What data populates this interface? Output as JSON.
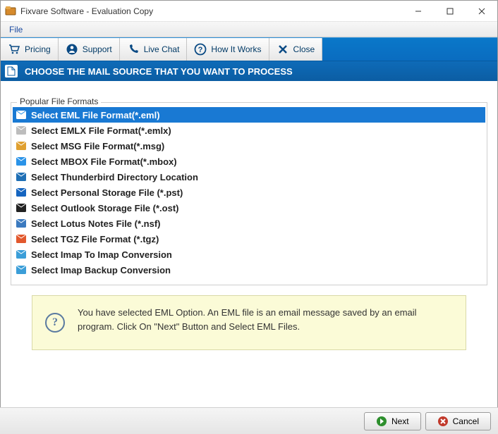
{
  "window": {
    "title": "Fixvare Software - Evaluation Copy"
  },
  "menubar": {
    "file": "File"
  },
  "toolbar": {
    "pricing": "Pricing",
    "support": "Support",
    "livechat": "Live Chat",
    "howitworks": "How It Works",
    "close": "Close"
  },
  "header": {
    "text": "CHOOSE THE MAIL SOURCE THAT YOU WANT TO PROCESS"
  },
  "group": {
    "title": "Popular File Formats"
  },
  "formats": [
    {
      "label": "Select EML File Format(*.eml)",
      "icon_color": "#2a93e8",
      "selected": true
    },
    {
      "label": "Select EMLX File Format(*.emlx)",
      "icon_color": "#bdbdbd",
      "selected": false
    },
    {
      "label": "Select MSG File Format(*.msg)",
      "icon_color": "#e0a030",
      "selected": false
    },
    {
      "label": "Select MBOX File Format(*.mbox)",
      "icon_color": "#2a93e8",
      "selected": false
    },
    {
      "label": "Select Thunderbird Directory Location",
      "icon_color": "#1f6fb5",
      "selected": false
    },
    {
      "label": "Select Personal Storage File (*.pst)",
      "icon_color": "#1565c0",
      "selected": false
    },
    {
      "label": "Select Outlook Storage File (*.ost)",
      "icon_color": "#222",
      "selected": false
    },
    {
      "label": "Select Lotus Notes File (*.nsf)",
      "icon_color": "#3b7abf",
      "selected": false
    },
    {
      "label": "Select TGZ File Format (*.tgz)",
      "icon_color": "#e2582d",
      "selected": false
    },
    {
      "label": "Select Imap To Imap Conversion",
      "icon_color": "#3b9ed8",
      "selected": false
    },
    {
      "label": "Select Imap Backup Conversion",
      "icon_color": "#3b9ed8",
      "selected": false
    }
  ],
  "info": {
    "text": "You have selected EML Option. An EML file is an email message saved by an email program. Click On \"Next\" Button and Select EML Files."
  },
  "footer": {
    "next": "Next",
    "cancel": "Cancel"
  }
}
